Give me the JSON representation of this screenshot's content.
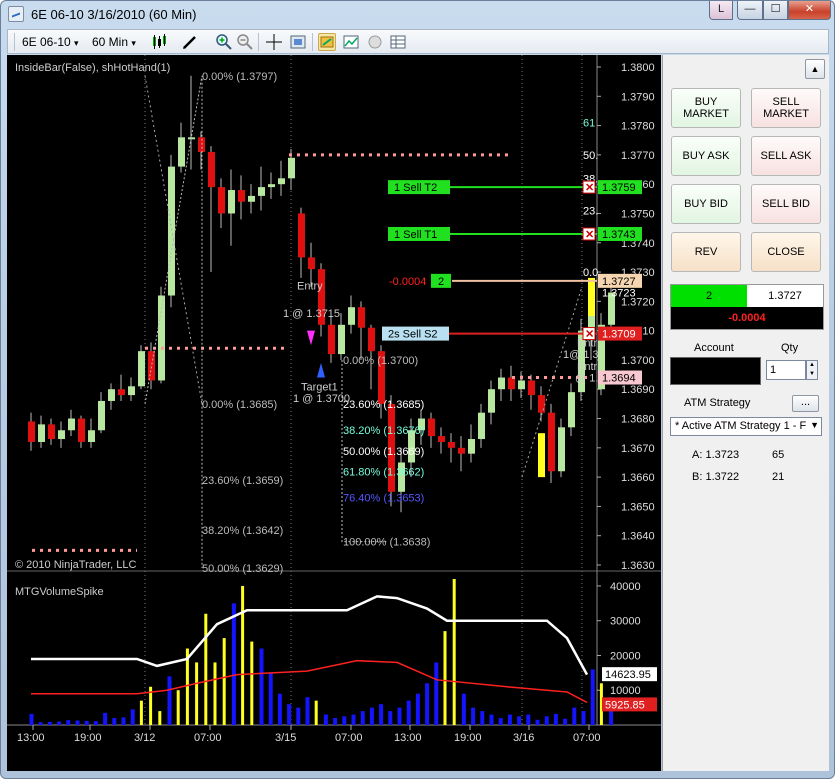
{
  "window": {
    "title": "6E 06-10  3/16/2010 (60 Min)",
    "btn_l": "L",
    "btn_min": "—",
    "btn_max": "☐",
    "btn_close": "✕"
  },
  "toolbar": {
    "instrument": "6E 06-10",
    "interval": "60 Min",
    "dropdown_glyph": "▾"
  },
  "chart": {
    "indicator_label": "InsideBar(False), shHotHand(1)",
    "copyright": "© 2010 NinjaTrader, LLC",
    "volume_label": "MTGVolumeSpike",
    "price_axis": [
      "1.3800",
      "1.3790",
      "1.3780",
      "1.3770",
      "1.3760",
      "1.3750",
      "1.3740",
      "1.3730",
      "1.3720",
      "1.3710",
      "1.3700",
      "1.3690",
      "1.3680",
      "1.3670",
      "1.3660",
      "1.3650",
      "1.3640",
      "1.3630"
    ],
    "volume_axis": [
      "40000",
      "30000",
      "20000",
      "10000"
    ],
    "time_axis": [
      "13:00",
      "19:00",
      "3/12",
      "07:00",
      "3/15",
      "07:00",
      "13:00",
      "19:00",
      "3/16",
      "07:00"
    ],
    "fib_left": [
      "0.00% (1.3797)",
      "0.00% (1.3685)",
      "23.60% (1.3659)",
      "38.20% (1.3642)",
      "50.00% (1.3629)"
    ],
    "fib_mid": [
      "0.00% (1.3700)",
      "23.60% (1.3685)",
      "38.20% (1.3676)",
      "50.00% (1.3669)",
      "61.80% (1.3662)",
      "76.40% (1.3653)",
      "100.00% (1.3638)"
    ],
    "fib_right": [
      "50.",
      "61",
      "38.",
      "23.",
      "0.0"
    ],
    "entry1": "Entry",
    "entry1_price": "1 @ 1.3715",
    "target1": "Target1",
    "target1_price": "1 @ 1.3700",
    "entry_right_a": "Entr",
    "entry_right_b": "1@ 1.3",
    "entry_right_c": "Entr",
    "entry_right_d": "@ 1.3",
    "orders": [
      {
        "label": "1  Sell T2",
        "price": "1.3759"
      },
      {
        "label": "1  Sell T1",
        "price": "1.3743"
      },
      {
        "label": "2s  Sell S2",
        "price": "1.3709"
      }
    ],
    "position_pnl": "-0.0004",
    "position_qty": "2",
    "last_price_tag": "1.3727",
    "price_1_3723": "1.3723",
    "price_1_3694": "1.3694",
    "vol_avg_tag": "14623.95",
    "vol_ema_tag": "5925.85",
    "colors": {
      "up": "#b8e8a0",
      "down": "#e01010",
      "spike": "#ffff20",
      "volume": "#1414ff",
      "target_line": "#20e020",
      "stop_line": "#e02020",
      "dots": "#ff9999"
    }
  },
  "panel": {
    "buy_market": "BUY\nMARKET",
    "sell_market": "SELL\nMARKET",
    "buy_ask": "BUY ASK",
    "sell_ask": "SELL ASK",
    "buy_bid": "BUY BID",
    "sell_bid": "SELL BID",
    "rev": "REV",
    "close": "CLOSE",
    "pos_qty": "2",
    "pos_price": "1.3727",
    "pos_pnl": "-0.0004",
    "account_label": "Account",
    "qty_label": "Qty",
    "qty_value": "1",
    "atm_label": "ATM Strategy",
    "atm_dots": "...",
    "atm_selected": "* Active ATM Strategy 1 - F",
    "level_a_label": "A: 1.3723",
    "level_a_size": "65",
    "level_b_label": "B: 1.3722",
    "level_b_size": "21"
  }
}
